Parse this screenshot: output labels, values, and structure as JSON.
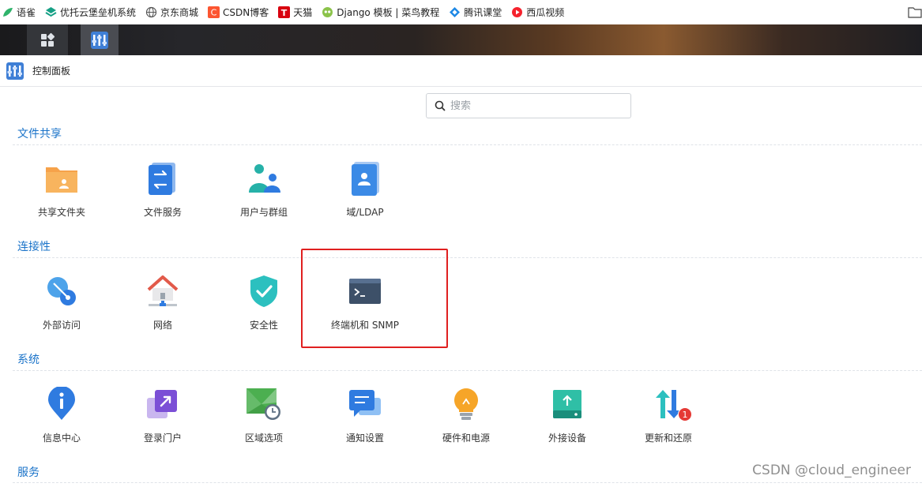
{
  "bookmarks": [
    {
      "label": "语雀",
      "icon": "yuque-icon"
    },
    {
      "label": "优托云堡垒机系统",
      "icon": "bastion-icon"
    },
    {
      "label": "京东商城",
      "icon": "globe-icon"
    },
    {
      "label": "CSDN博客",
      "icon": "csdn-icon"
    },
    {
      "label": "天猫",
      "icon": "tmall-icon"
    },
    {
      "label": "Django 模板 | 菜鸟教程",
      "icon": "runoob-icon"
    },
    {
      "label": "腾讯课堂",
      "icon": "tencent-class-icon"
    },
    {
      "label": "西瓜视频",
      "icon": "xigua-icon"
    }
  ],
  "window": {
    "title": "控制面板"
  },
  "search": {
    "placeholder": "搜索",
    "value": ""
  },
  "sections": {
    "file_sharing": {
      "title": "文件共享",
      "items": [
        "共享文件夹",
        "文件服务",
        "用户与群组",
        "域/LDAP"
      ]
    },
    "connectivity": {
      "title": "连接性",
      "items": [
        "外部访问",
        "网络",
        "安全性",
        "终端机和 SNMP"
      ]
    },
    "system": {
      "title": "系统",
      "items": [
        "信息中心",
        "登录门户",
        "区域选项",
        "通知设置",
        "硬件和电源",
        "外接设备",
        "更新和还原"
      ],
      "update_badge": "1"
    },
    "services": {
      "title": "服务"
    }
  },
  "colors": {
    "section_title": "#1a73c9",
    "highlight": "#e02020",
    "badge": "#e53935"
  },
  "watermark": "CSDN @cloud_engineer"
}
